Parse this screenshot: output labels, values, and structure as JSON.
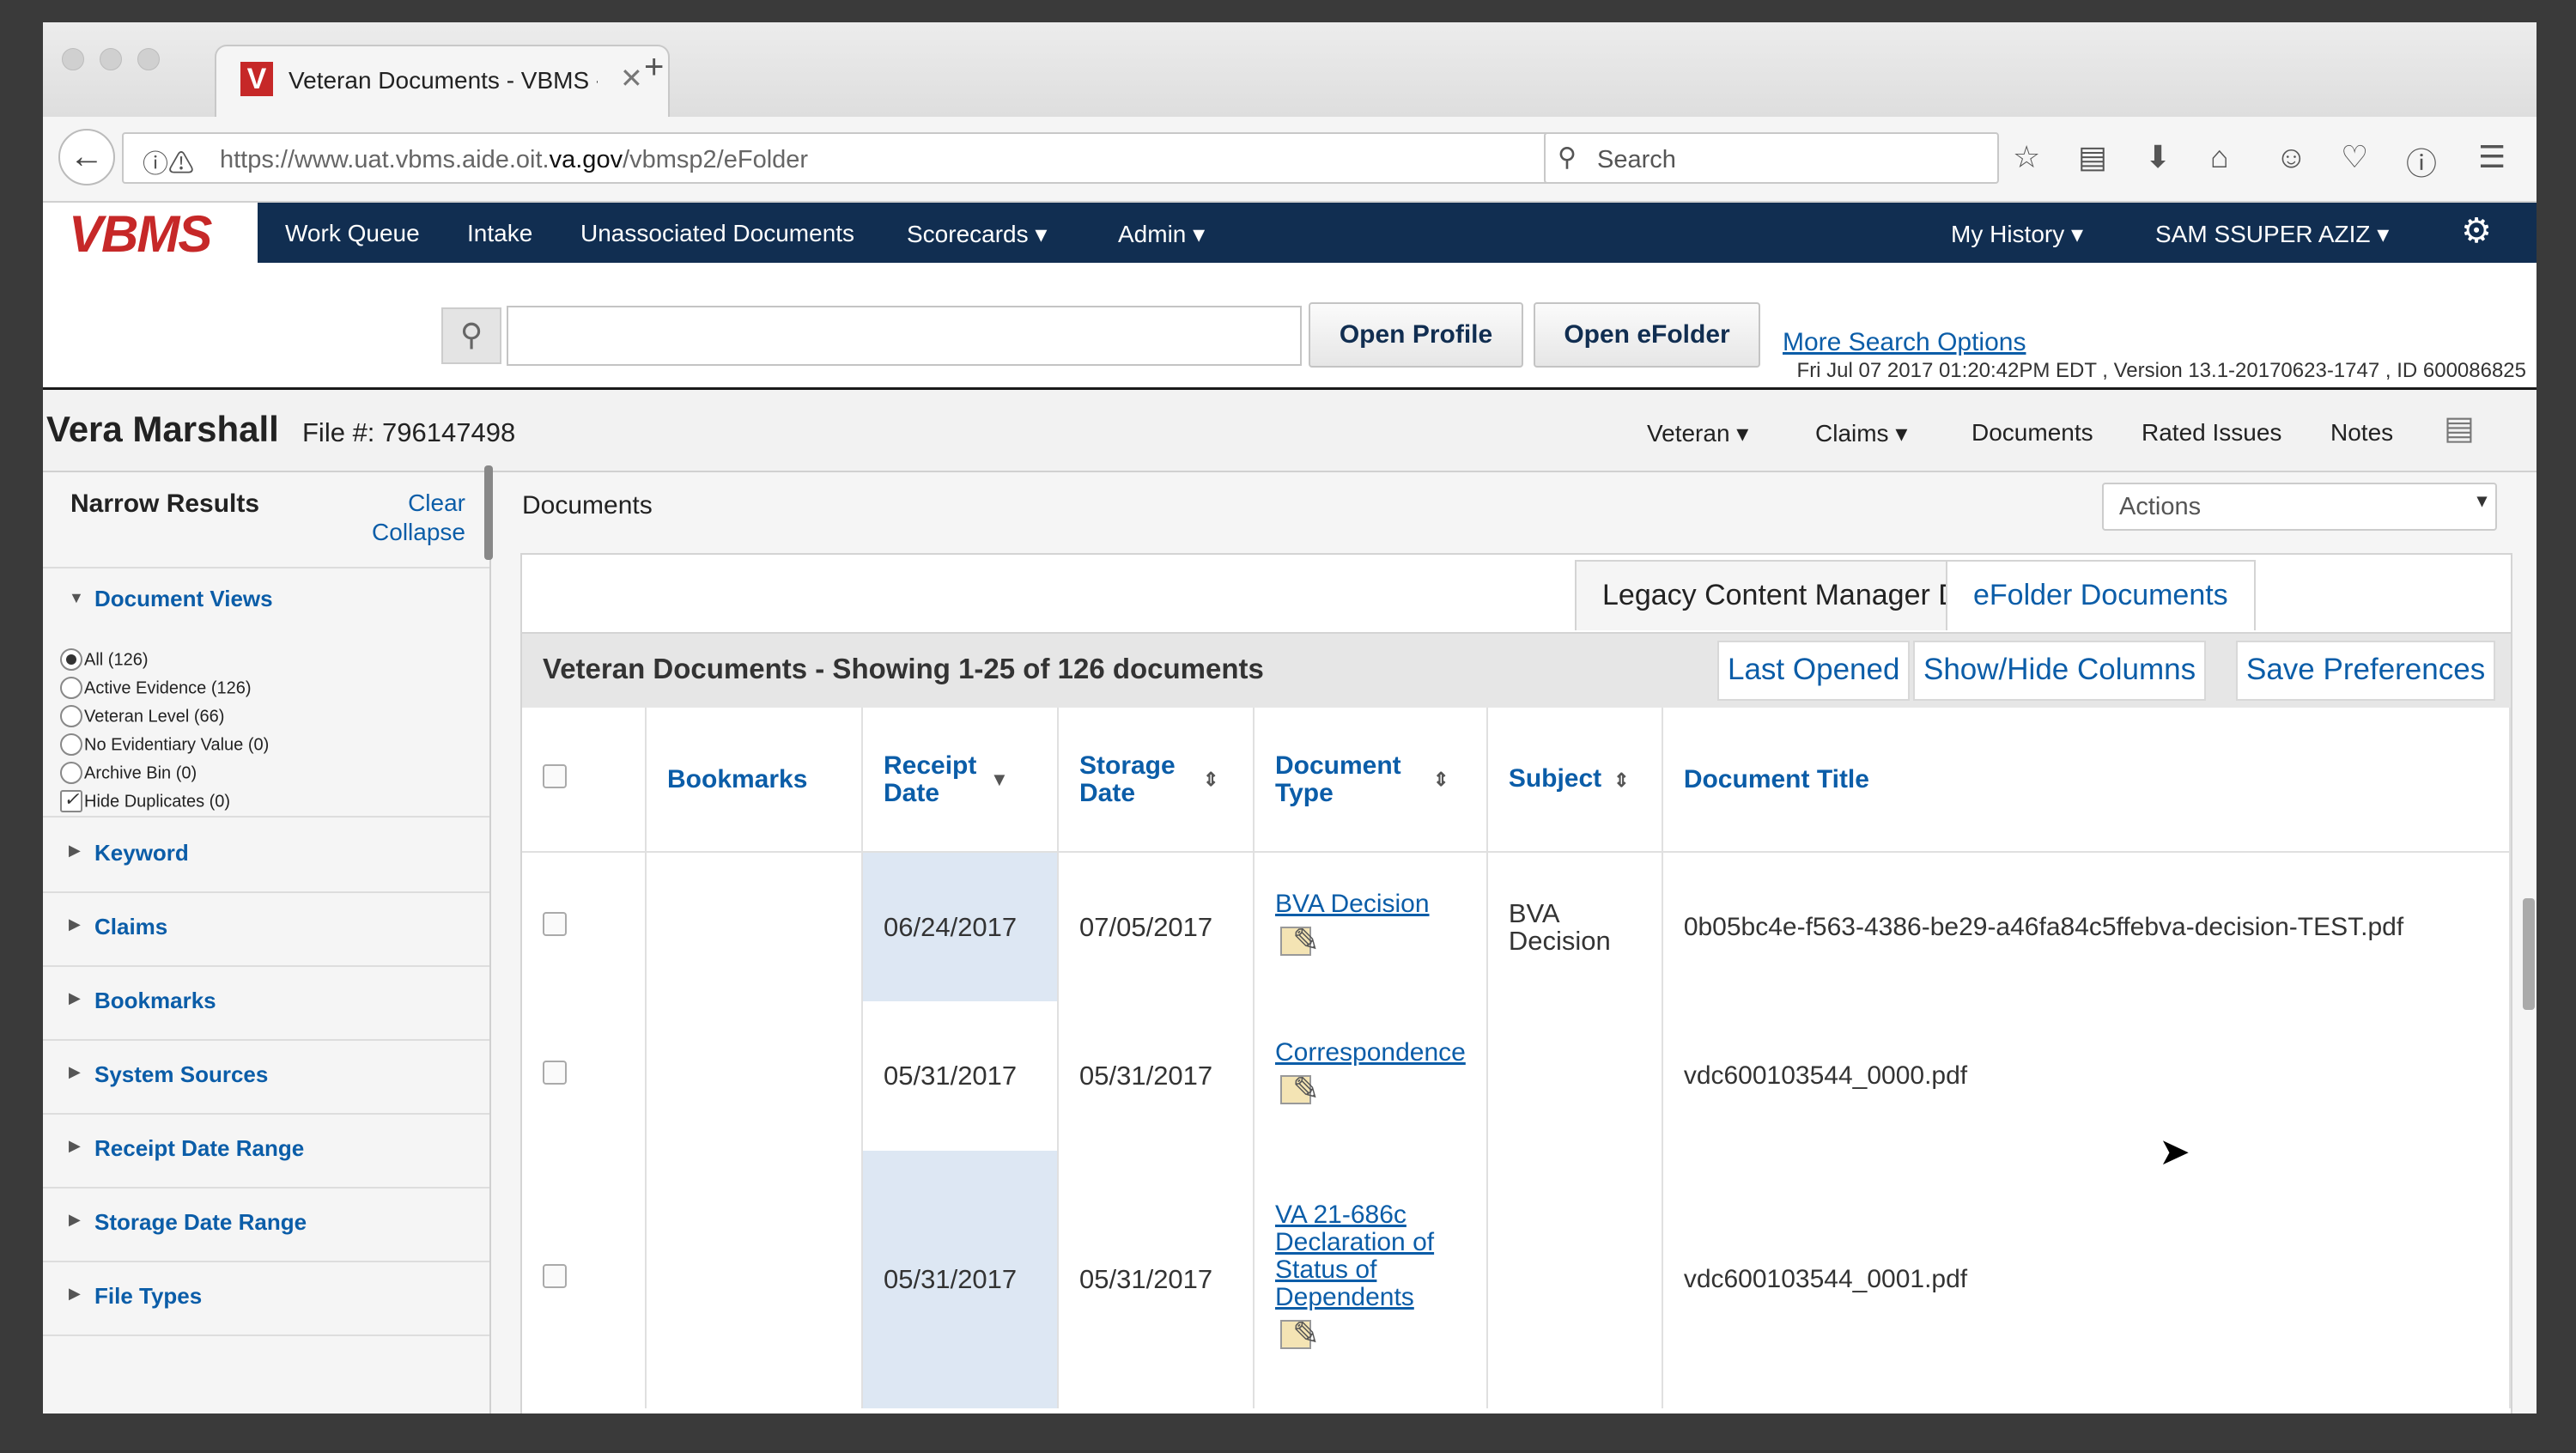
{
  "browser": {
    "tab_title": "Veteran Documents - VBMS - \\",
    "tab_favicon": "V",
    "url_prefix": "https://www.uat.vbms.aide.oit.",
    "url_domain": "va.gov",
    "url_path": "/vbmsp2/eFolder",
    "search_placeholder": "Search"
  },
  "app": {
    "logo": "VBMS",
    "menu": [
      "Work Queue",
      "Intake",
      "Unassociated Documents",
      "Scorecards",
      "Admin"
    ],
    "right_menu": [
      "My History",
      "SAM SSUPER AZIZ"
    ]
  },
  "search": {
    "open_profile": "Open Profile",
    "open_efolder": "Open eFolder",
    "more_options": "More Search Options",
    "version_info": "Fri Jul 07 2017 01:20:42PM EDT , Version 13.1-20170623-1747 , ID 600086825"
  },
  "veteran": {
    "name": "Vera Marshall",
    "file_label": "File #: 796147498",
    "nav": [
      "Veteran",
      "Claims",
      "Documents",
      "Rated Issues",
      "Notes"
    ]
  },
  "sidebar": {
    "title": "Narrow Results",
    "clear": "Clear",
    "collapse": "Collapse",
    "views_title": "Document Views",
    "views": [
      "All (126)",
      "Active Evidence (126)",
      "Veteran Level (66)",
      "No Evidentiary Value (0)",
      "Archive Bin (0)",
      "Hide Duplicates (0)"
    ],
    "sections": [
      "Keyword",
      "Claims",
      "Bookmarks",
      "System Sources",
      "Receipt Date Range",
      "Storage Date Range",
      "File Types"
    ]
  },
  "main": {
    "title": "Documents",
    "actions": "Actions",
    "tab_legacy": "Legacy Content Manager Documents",
    "tab_efolder": "eFolder Documents",
    "count_text": "Veteran Documents - Showing 1-25 of 126 documents",
    "last_opened": "Last Opened",
    "show_hide": "Show/Hide Columns",
    "save_prefs": "Save Preferences",
    "headers": [
      "Bookmarks",
      "Receipt Date",
      "Storage Date",
      "Document Type",
      "Subject",
      "Document Title"
    ],
    "rows": [
      {
        "receipt": "06/24/2017",
        "storage": "07/05/2017",
        "type": "BVA Decision",
        "subject": "BVA Decision",
        "title": "0b05bc4e-f563-4386-be29-a46fa84c5ffebva-decision-TEST.pdf"
      },
      {
        "receipt": "05/31/2017",
        "storage": "05/31/2017",
        "type": "Correspondence",
        "subject": "",
        "title": "vdc600103544_0000.pdf"
      },
      {
        "receipt": "05/31/2017",
        "storage": "05/31/2017",
        "type": "VA 21-686c Declaration of Status of Dependents",
        "subject": "",
        "title": "vdc600103544_0001.pdf"
      }
    ]
  }
}
